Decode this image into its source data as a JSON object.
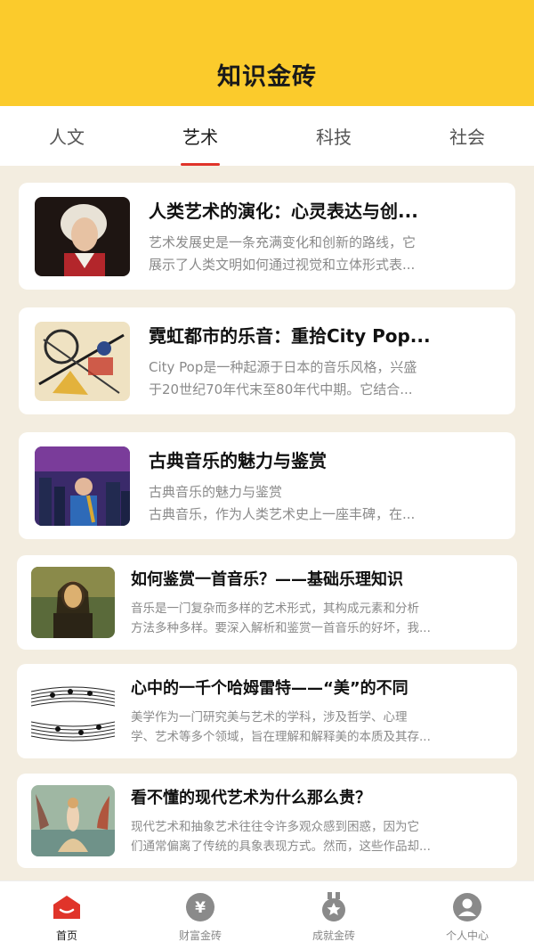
{
  "header": {
    "title": "知识金砖"
  },
  "tabs": [
    {
      "label": "人文"
    },
    {
      "label": "艺术"
    },
    {
      "label": "科技"
    },
    {
      "label": "社会"
    }
  ],
  "active_tab": "艺术",
  "articles": [
    {
      "title": "人类艺术的演化：心灵表达与创...",
      "desc_line1": "艺术发展史是一条充满变化和创新的路线，它",
      "desc_line2": "展示了人类文明如何通过视觉和立体形式表..."
    },
    {
      "title": "霓虹都市的乐音：重拾City Pop...",
      "desc_line1": "City Pop是一种起源于日本的音乐风格，兴盛",
      "desc_line2": "于20世纪70年代末至80年代中期。它结合..."
    },
    {
      "title": "古典音乐的魅力与鉴赏",
      "desc_line1": "古典音乐的魅力与鉴赏",
      "desc_line2": "古典音乐，作为人类艺术史上一座丰碑，在..."
    },
    {
      "title": "如何鉴赏一首音乐？——基础乐理知识",
      "desc_line1": "音乐是一门复杂而多样的艺术形式，其构成元素和分析",
      "desc_line2": "方法多种多样。要深入解析和鉴赏一首音乐的好坏，我..."
    },
    {
      "title": "心中的一千个哈姆雷特——“美”的不同",
      "desc_line1": "美学作为一门研究美与艺术的学科，涉及哲学、心理",
      "desc_line2": "学、艺术等多个领域，旨在理解和解释美的本质及其存..."
    },
    {
      "title": "看不懂的现代艺术为什么那么贵？",
      "desc_line1": "现代艺术和抽象艺术往往令许多观众感到困惑，因为它",
      "desc_line2": "们通常偏离了传统的具象表现方式。然而，这些作品却..."
    }
  ],
  "bottom_nav": [
    {
      "label": "首页",
      "icon": "home-icon"
    },
    {
      "label": "财富金砖",
      "icon": "yuan-coin-icon"
    },
    {
      "label": "成就金砖",
      "icon": "medal-icon"
    },
    {
      "label": "个人中心",
      "icon": "user-icon"
    }
  ],
  "colors": {
    "header_bg": "#fbcb2c",
    "accent": "#e0342a",
    "page_bg": "#f3ede0"
  }
}
